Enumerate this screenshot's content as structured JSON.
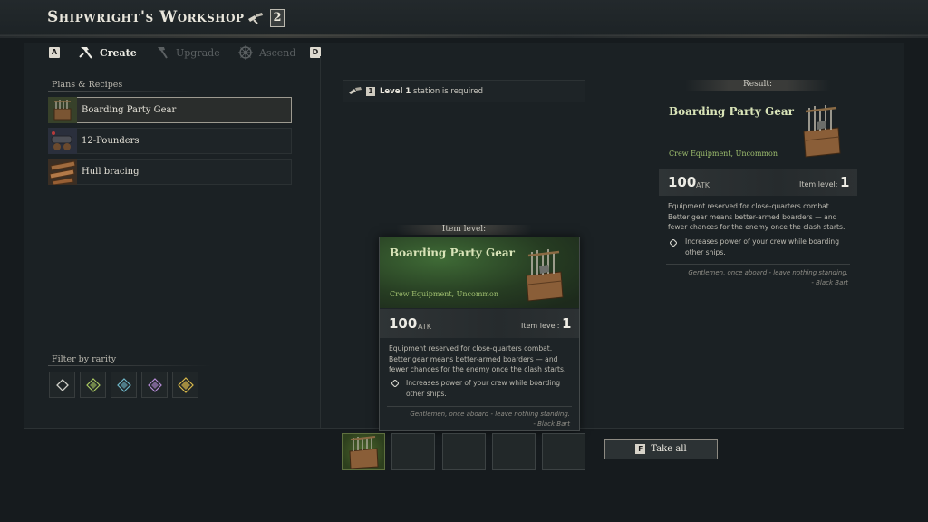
{
  "header": {
    "title": "Shipwright's Workshop",
    "station_level": "2"
  },
  "tabs": {
    "prev_key": "A",
    "next_key": "D",
    "create": "Create",
    "upgrade": "Upgrade",
    "ascend": "Ascend"
  },
  "recipes": {
    "section_label": "Plans & Recipes",
    "items": [
      {
        "label": "Boarding Party Gear"
      },
      {
        "label": "12-Pounders"
      },
      {
        "label": "Hull bracing"
      }
    ]
  },
  "filter": {
    "section_label": "Filter by rarity",
    "rarities": [
      "common",
      "uncommon",
      "rare",
      "epic",
      "legendary"
    ],
    "colors": [
      "#cfcfc8",
      "#a9c861",
      "#6fb7c9",
      "#b58bd6",
      "#d8b84a"
    ]
  },
  "requirement": {
    "level_key": "1",
    "level_text": "Level 1",
    "text": " station is required"
  },
  "result": {
    "label": "Result:",
    "name": "Boarding Party Gear",
    "subtitle": "Crew Equipment, Uncommon",
    "atk_value": "100",
    "atk_unit": "ATK",
    "item_level_label": "Item level:",
    "item_level": "1",
    "description": "Equipment reserved for close-quarters combat. Better gear means better-armed boarders — and fewer chances for the enemy once the clash starts.",
    "bullet": "Increases power of your crew while boarding other ships.",
    "quote": "Gentlemen, once aboard - leave nothing standing.",
    "quote_author": "- Black Bart"
  },
  "tooltip": {
    "label": "Item level:",
    "name": "Boarding Party Gear",
    "subtitle": "Crew Equipment, Uncommon",
    "atk_value": "100",
    "atk_unit": "ATK",
    "item_level_label": "Item level:",
    "item_level": "1",
    "description": "Equipment reserved for close-quarters combat. Better gear means better-armed boarders — and fewer chances for the enemy once the clash starts.",
    "bullet": "Increases power of your crew while boarding other ships.",
    "quote": "Gentlemen, once aboard - leave nothing standing.",
    "quote_author": "- Black Bart"
  },
  "actions": {
    "take_all_key": "F",
    "take_all": "Take all"
  },
  "colors": {
    "uncommon_green": "#9fbf6f",
    "selected_border": "#9d9a90"
  }
}
